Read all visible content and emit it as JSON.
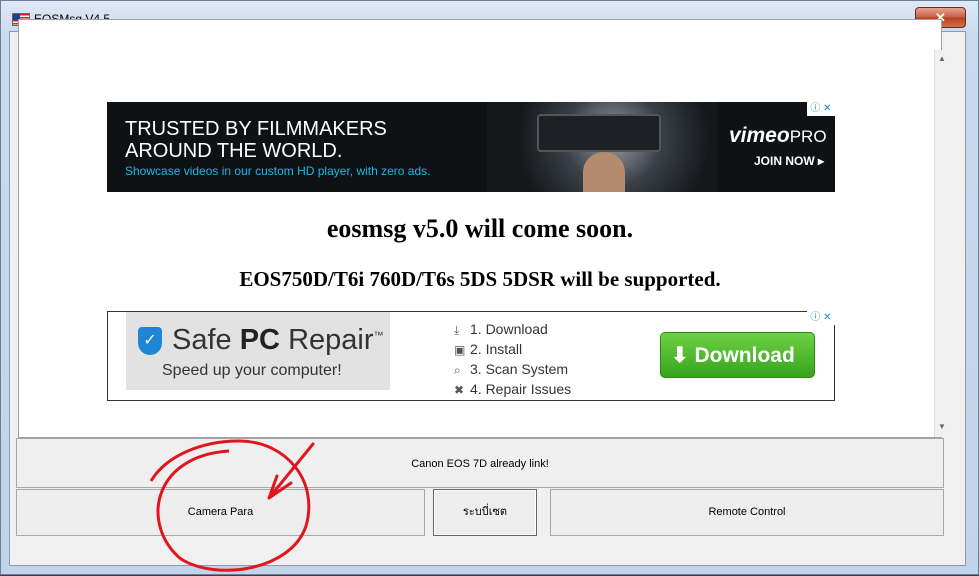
{
  "window": {
    "title": "EOSMsg V4.5",
    "close_label": "✕"
  },
  "ad_top": {
    "headline": "TRUSTED BY FILMMAKERS AROUND THE WORLD.",
    "subline": "Showcase videos in our custom HD player, with zero ads.",
    "brand": "vimeo",
    "brand_suffix": "PRO",
    "cta": "JOIN NOW ▸",
    "adchoices": "ⓘ ✕"
  },
  "content": {
    "headline": "eosmsg v5.0 will come soon.",
    "subheadline": "EOS750D/T6i 760D/T6s 5DS 5DSR will be supported."
  },
  "ad_bottom": {
    "brand_prefix": "Safe ",
    "brand_bold": "PC",
    "brand_suffix": " Repair",
    "trademark": "™",
    "tagline": "Speed up your computer!",
    "steps": [
      "1. Download",
      "2. Install",
      "3. Scan System",
      "4. Repair Issues"
    ],
    "download_label": "Download",
    "adchoices": "ⓘ ✕"
  },
  "status": {
    "text": "Canon EOS 7D already link!"
  },
  "buttons": {
    "camera_para": "Camera Para",
    "language": "ระบบี่เซต",
    "remote_control": "Remote Control"
  },
  "colors": {
    "annotation": "#e0151d",
    "vimeo_blue": "#19b7ea",
    "download_green": "#36a41b"
  }
}
